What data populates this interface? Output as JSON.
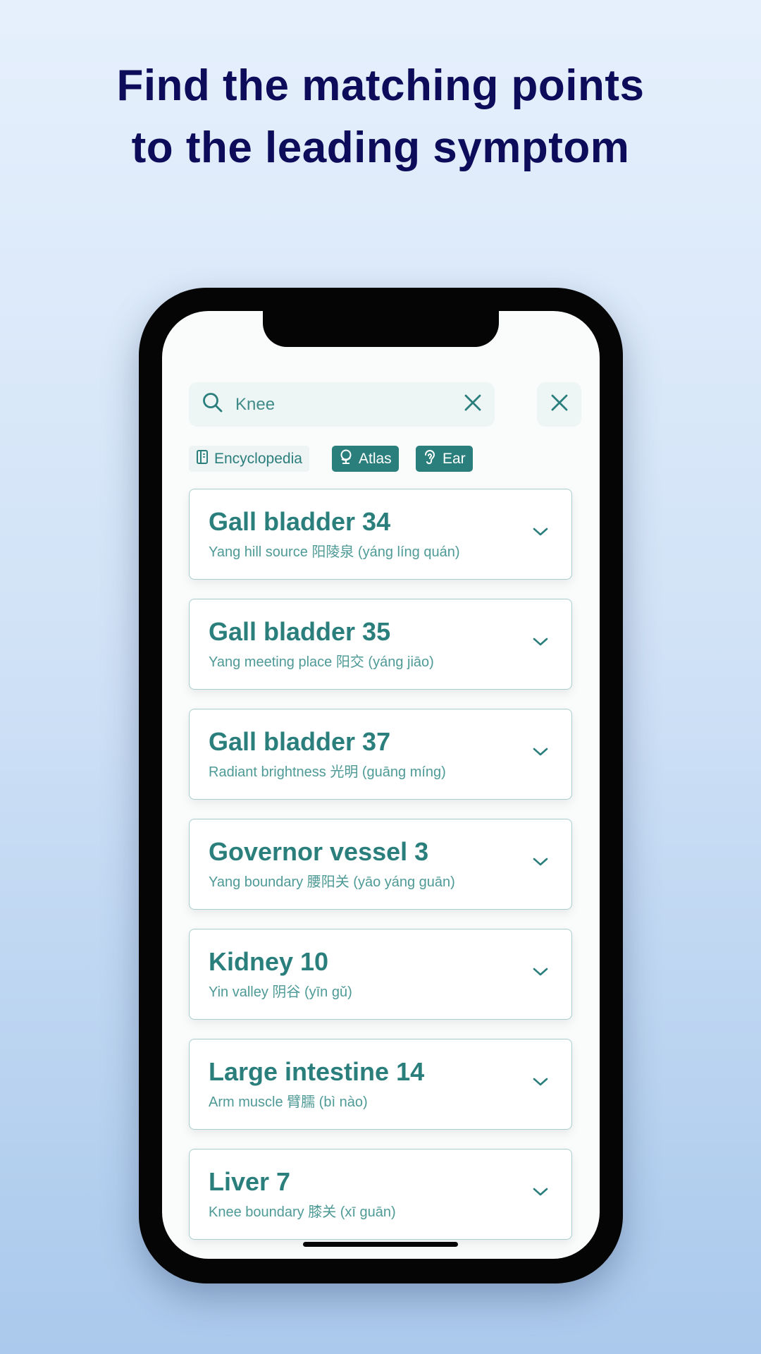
{
  "headline": {
    "line1": "Find the matching points",
    "line2": "to the leading symptom"
  },
  "search": {
    "value": "Knee",
    "icon": "search-icon",
    "clear_icon": "close-icon"
  },
  "close_button_icon": "close-icon",
  "filters": [
    {
      "label": "Encyclopedia",
      "icon": "book-icon",
      "active": false
    },
    {
      "label": "Atlas",
      "icon": "globe-icon",
      "active": true
    },
    {
      "label": "Ear",
      "icon": "ear-icon",
      "active": true
    }
  ],
  "results": [
    {
      "title": "Gall bladder 34",
      "subtitle": "Yang hill source 阳陵泉 (yáng líng quán)"
    },
    {
      "title": "Gall bladder 35",
      "subtitle": "Yang meeting place 阳交 (yáng jiāo)"
    },
    {
      "title": "Gall bladder 37",
      "subtitle": "Radiant brightness 光明 (guāng míng)"
    },
    {
      "title": "Governor vessel 3",
      "subtitle": "Yang boundary 腰阳关 (yāo yáng guān)"
    },
    {
      "title": "Kidney 10",
      "subtitle": "Yin valley 阴谷 (yīn gǔ)"
    },
    {
      "title": "Large intestine 14",
      "subtitle": "Arm muscle 臂臑 (bì nào)"
    },
    {
      "title": "Liver 7",
      "subtitle": "Knee boundary 膝关 (xī guān)"
    }
  ],
  "colors": {
    "accent": "#2a7f7c",
    "headline": "#0c0c5a"
  }
}
